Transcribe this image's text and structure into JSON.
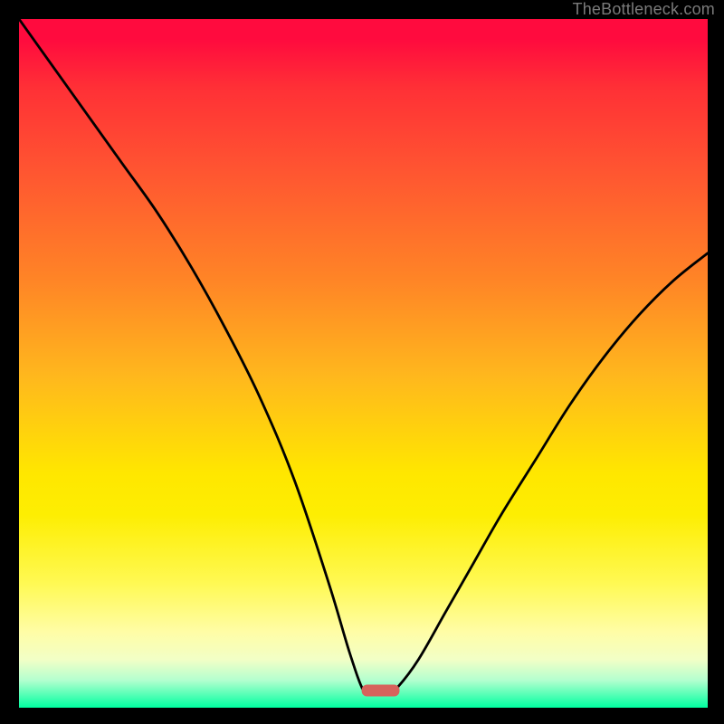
{
  "watermark": "TheBottleneck.com",
  "chart_data": {
    "type": "line",
    "title": "",
    "xlabel": "",
    "ylabel": "",
    "xlim": [
      0,
      100
    ],
    "ylim": [
      0,
      100
    ],
    "series": [
      {
        "name": "left-branch",
        "x": [
          0,
          5,
          10,
          15,
          20,
          25,
          30,
          35,
          40,
          45,
          48,
          50,
          51
        ],
        "y": [
          100,
          93,
          86,
          79,
          72,
          64,
          55,
          45,
          33,
          18,
          8,
          2.5,
          2.5
        ]
      },
      {
        "name": "right-branch",
        "x": [
          54,
          55,
          58,
          62,
          66,
          70,
          75,
          80,
          85,
          90,
          95,
          100
        ],
        "y": [
          2.5,
          3,
          7,
          14,
          21,
          28,
          36,
          44,
          51,
          57,
          62,
          66
        ]
      }
    ],
    "marker": {
      "name": "optimal-marker",
      "x": 52.5,
      "y": 2.5,
      "width": 5.5,
      "color": "#d6635c"
    },
    "gradient_meaning": "background vertical gradient: top=red (bad), bottom=green (good)"
  }
}
